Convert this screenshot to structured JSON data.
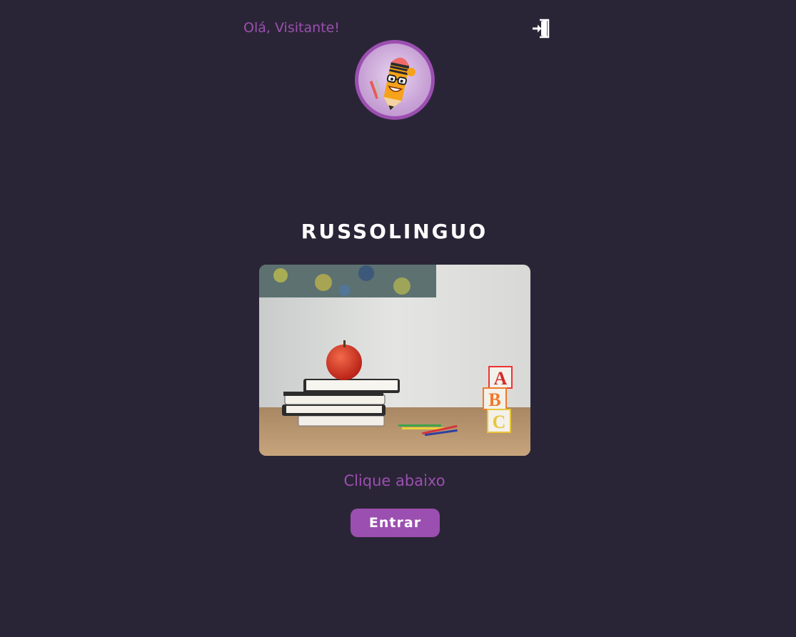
{
  "header": {
    "greeting": "Olá, Visitante!",
    "login_icon": "login-door-icon"
  },
  "avatar": {
    "icon": "pencil-mascot-icon"
  },
  "main": {
    "title": "RUSSOLINGUO",
    "hero_image": "books-apple-abc-blocks-image",
    "subtitle": "Clique abaixo",
    "enter_label": "Entrar"
  },
  "colors": {
    "background": "#2a2536",
    "accent": "#9b4fb0",
    "text": "#ffffff"
  }
}
